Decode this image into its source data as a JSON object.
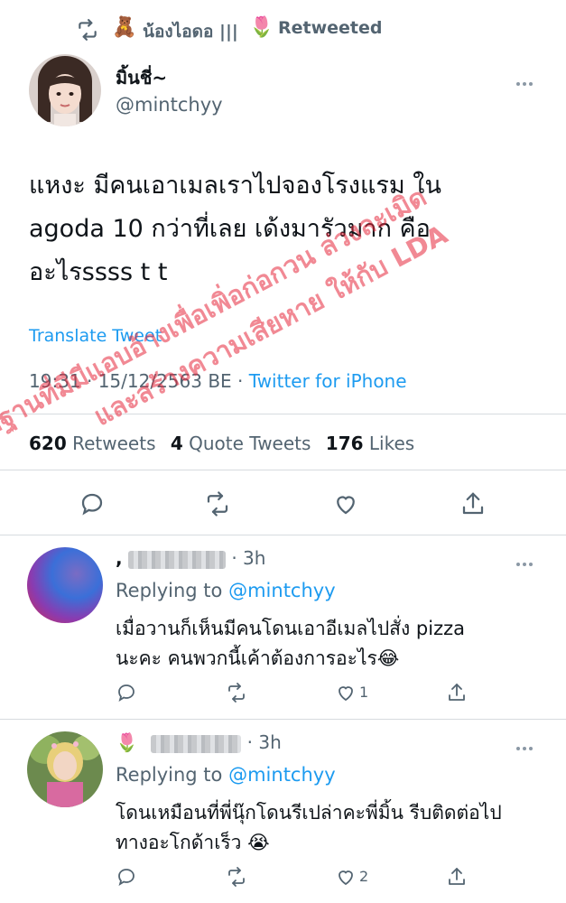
{
  "retweet_header": {
    "emoji_left": "🧸",
    "name": "น้องไอดอ |||",
    "emoji_right": "🌷",
    "status": "Retweeted"
  },
  "tweet": {
    "display_name": "มิ้นชี่~",
    "handle": "@mintchyy",
    "text_line1": "แหงะ มีคนเอาเมลเราไปจองโรงแรม ใน",
    "text_line2": "agoda 10 กว่าที่เลย เด้งมารัวมาก คือ",
    "text_line3": "อะไรssss t t",
    "translate": "Translate Tweet",
    "timestamp": "19:31 · 15/12/2563 BE ·",
    "source": "Twitter for iPhone",
    "retweets_count": "620",
    "retweets_label": "Retweets",
    "quotes_count": "4",
    "quotes_label": "Quote Tweets",
    "likes_count": "176",
    "likes_label": "Likes"
  },
  "replies": [
    {
      "name_prefix": ",",
      "time": "· 3h",
      "replying_label": "Replying to",
      "replying_handle": "@mintchyy",
      "line1": "เมื่อวานก็เห็นมีคนโดนเอาอีเมลไปสั่ง pizza",
      "line2": "นะคะ คนพวกนี้เค้าต้องการอะไร😂",
      "like_count": "1"
    },
    {
      "name_prefix": "🌷",
      "time": "· 3h",
      "replying_label": "Replying to",
      "replying_handle": "@mintchyy",
      "line1": "โดนเหมือนที่พี่นุ๊กโดนรีเปล่าคะพี่มิ้น รีบติดต่อไป",
      "line2": "ทางอะโกด้าเร็ว 😭",
      "like_count": "2"
    }
  ],
  "watermark": {
    "line1": "หลักฐานที่มีมีแอบอ้างเพื่อเพิ่อก่อกวน ล่วงละเมิด",
    "line2": "และสร้างความเสียหาย ให้กับ LDA"
  },
  "colors": {
    "accent": "#1d9bf0",
    "muted": "#536471",
    "text": "#0f1419",
    "watermark": "#e6283c"
  }
}
